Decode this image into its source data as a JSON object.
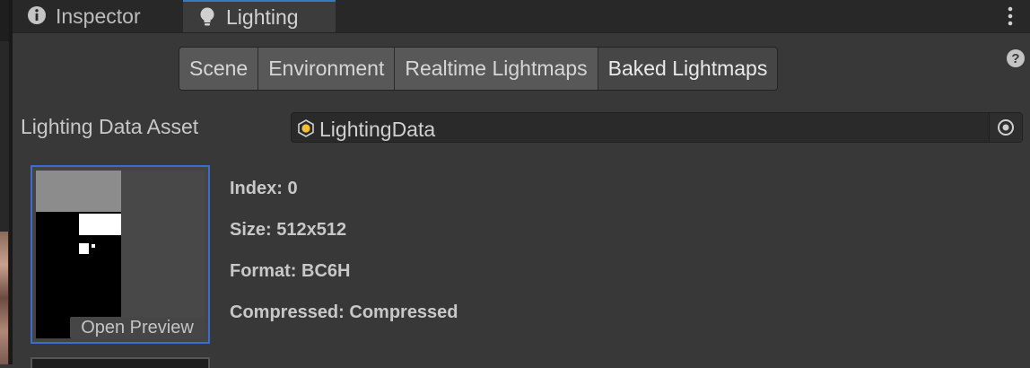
{
  "tabs": {
    "inspector": "Inspector",
    "lighting": "Lighting"
  },
  "toolbar": {
    "buttons": [
      "Scene",
      "Environment",
      "Realtime Lightmaps",
      "Baked Lightmaps"
    ],
    "selected": "Baked Lightmaps"
  },
  "asset": {
    "label": "Lighting Data Asset",
    "value": "LightingData"
  },
  "lightmap": {
    "open_preview": "Open Preview",
    "index": "Index: 0",
    "size": "Size: 512x512",
    "format": "Format: BC6H",
    "compressed": "Compressed: Compressed"
  },
  "colors": {
    "background": "#383838",
    "tabbar": "#282828",
    "accent": "#3d6bd1",
    "asset_icon": "#f2c12e"
  }
}
